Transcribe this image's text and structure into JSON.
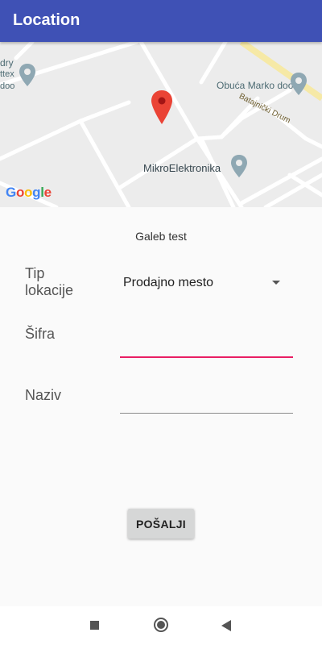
{
  "app_bar": {
    "title": "Location",
    "color": "#3f51b5"
  },
  "map": {
    "labels": {
      "left_top": "dry",
      "left_mid": "ttex",
      "left_bottom": "doo",
      "shop": "Obuća Marko doo",
      "road": "Batajnički Drum",
      "poi": "MikroElektronika"
    },
    "attribution": [
      "G",
      "o",
      "o",
      "g",
      "l",
      "e"
    ],
    "marker_icon": "map-pin-icon",
    "poi_icon": "place-icon"
  },
  "form": {
    "title": "Galeb test",
    "tip_lokacije": {
      "label_line1": "Tip",
      "label_line2": "lokacije",
      "selected": "Prodajno mesto"
    },
    "sifra": {
      "label": "Šifra",
      "value": ""
    },
    "naziv": {
      "label": "Naziv",
      "value": ""
    },
    "submit_label": "POŠALJI",
    "accent_color": "#e91e63"
  },
  "navigation_bar": {
    "recents_icon": "square-icon",
    "home_icon": "circle-icon",
    "back_icon": "triangle-back-icon"
  }
}
